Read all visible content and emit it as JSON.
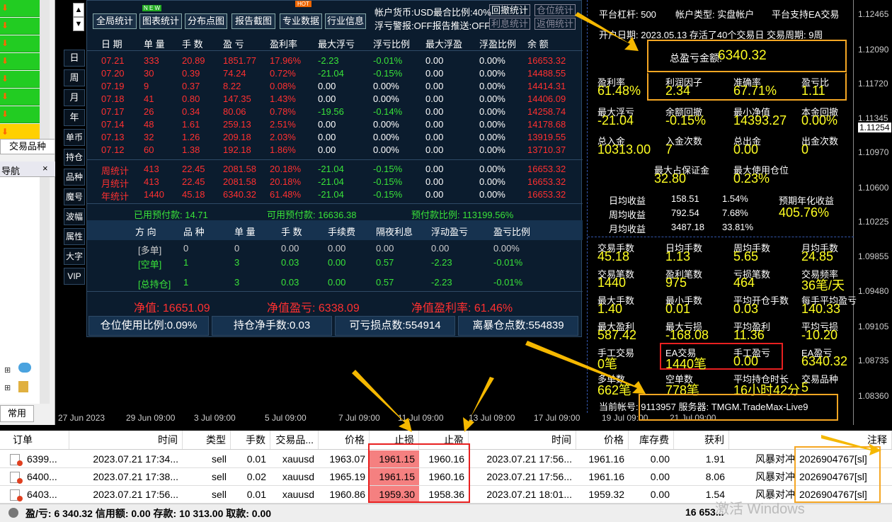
{
  "left": {
    "tab1": "交易品种",
    "nav": "导航",
    "close": "×",
    "common": "常用"
  },
  "topbuttons": [
    "全局统计",
    "图表统计",
    "分布点图",
    "报告截图",
    "专业数据",
    "行业信息"
  ],
  "badges": {
    "new": "N E W",
    "hot": "HOT"
  },
  "account_line1": "帐户货币:USD最合比例:40%",
  "account_line2": "浮亏警报:OFF报告推送:OFF",
  "actbtns": [
    "回撤统计",
    "仓位统计",
    "利息统计",
    "返佣统计"
  ],
  "side_tabs": [
    "日",
    "周",
    "月",
    "年",
    "单币",
    "持仓",
    "品种",
    "魔号",
    "波幅",
    "属性",
    "大字",
    "VIP"
  ],
  "headers": [
    "日 期",
    "单 量",
    "手 数",
    "盈 亏",
    "盈利率",
    "最大浮亏",
    "浮亏比例",
    "最大浮盈",
    "浮盈比例",
    "余 额"
  ],
  "rows": [
    [
      "07.21",
      "333",
      "20.89",
      "1851.77",
      "17.96%",
      "-2.23",
      "-0.01%",
      "0.00",
      "0.00%",
      "16653.32"
    ],
    [
      "07.20",
      "30",
      "0.39",
      "74.24",
      "0.72%",
      "-21.04",
      "-0.15%",
      "0.00",
      "0.00%",
      "14488.55"
    ],
    [
      "07.19",
      "9",
      "0.37",
      "8.22",
      "0.08%",
      "0.00",
      "0.00%",
      "0.00",
      "0.00%",
      "14414.31"
    ],
    [
      "07.18",
      "41",
      "0.80",
      "147.35",
      "1.43%",
      "0.00",
      "0.00%",
      "0.00",
      "0.00%",
      "14406.09"
    ],
    [
      "07.17",
      "26",
      "0.34",
      "80.06",
      "0.78%",
      "-19.56",
      "-0.14%",
      "0.00",
      "0.00%",
      "14258.74"
    ],
    [
      "07.14",
      "48",
      "1.61",
      "259.13",
      "2.51%",
      "0.00",
      "0.00%",
      "0.00",
      "0.00%",
      "14178.68"
    ],
    [
      "07.13",
      "32",
      "1.26",
      "209.18",
      "2.03%",
      "0.00",
      "0.00%",
      "0.00",
      "0.00%",
      "13919.55"
    ],
    [
      "07.12",
      "60",
      "1.38",
      "192.18",
      "1.86%",
      "0.00",
      "0.00%",
      "0.00",
      "0.00%",
      "13710.37"
    ]
  ],
  "sumrows": [
    [
      "周统计",
      "413",
      "22.45",
      "2081.58",
      "20.18%",
      "-21.04",
      "-0.15%",
      "0.00",
      "0.00%",
      "16653.32"
    ],
    [
      "月统计",
      "413",
      "22.45",
      "2081.58",
      "20.18%",
      "-21.04",
      "-0.15%",
      "0.00",
      "0.00%",
      "16653.32"
    ],
    [
      "年统计",
      "1440",
      "45.18",
      "6340.32",
      "61.48%",
      "-21.04",
      "-0.15%",
      "0.00",
      "0.00%",
      "16653.32"
    ]
  ],
  "margin": {
    "used": "已用预付款: 14.71",
    "avail": "可用预付款: 16636.38",
    "ratio": "预付款比例: 113199.56%"
  },
  "pos_headers": [
    "方 向",
    "品 种",
    "单 量",
    "手 数",
    "手续费",
    "隔夜利息",
    "浮动盈亏",
    "盈亏比例"
  ],
  "pos_rows": [
    [
      "[多单]",
      "0",
      "0",
      "0.00",
      "0.00",
      "0.00",
      "0.00",
      "0.00%"
    ],
    [
      "[空单]",
      "1",
      "3",
      "0.03",
      "0.00",
      "0.57",
      "-2.23",
      "-0.01%"
    ],
    [
      "[总持仓]",
      "1",
      "3",
      "0.03",
      "0.00",
      "0.57",
      "-2.23",
      "-0.01%"
    ]
  ],
  "netline": {
    "equity": "净值: 16651.09",
    "profit": "净值盈亏: 6338.09",
    "rate": "净值盈利率: 61.46%"
  },
  "bottombar": [
    "仓位使用比例:0.09%",
    "持仓净手数:0.03",
    "可亏损点数:554914",
    "离暴仓点数:554839"
  ],
  "right": {
    "lev": "平台杠杆: 500",
    "acctype": "帐户类型: 实盘帐户",
    "ea": "平台支持EA交易",
    "open": "开户日期: 2023.05.13 存活了40个交易日 交易周期: 9周",
    "total_label": "总盈亏金额:",
    "total": "6340.32",
    "g1": [
      [
        "盈利率",
        "61.48%"
      ],
      [
        "利润因子",
        "2.34"
      ],
      [
        "准确率",
        "67.71%"
      ],
      [
        "盈亏比",
        "1.11"
      ]
    ],
    "g2": [
      [
        "最大浮亏",
        "-21.04"
      ],
      [
        "余额回撤",
        "-0.15%"
      ],
      [
        "最小净值",
        "14393.27"
      ],
      [
        "本金回撤",
        "0.00%"
      ]
    ],
    "g3": [
      [
        "总入金",
        "10313.00"
      ],
      [
        "入金次数",
        "7"
      ],
      [
        "总出金",
        "0.00"
      ],
      [
        "出金次数",
        "0"
      ]
    ],
    "g4": [
      [
        "最大占保证金",
        "32.80"
      ],
      [
        "最大使用仓位",
        "0.23%"
      ]
    ],
    "daily": [
      [
        "日均收益",
        "158.51",
        "1.54%"
      ],
      [
        "周均收益",
        "792.54",
        "7.68%"
      ],
      [
        "月均收益",
        "3487.18",
        "33.81%"
      ]
    ],
    "annual_label": "预期年化收益",
    "annual": "405.76%",
    "g5": [
      [
        "交易手数",
        "45.18"
      ],
      [
        "日均手数",
        "1.13"
      ],
      [
        "周均手数",
        "5.65"
      ],
      [
        "月均手数",
        "24.85"
      ]
    ],
    "g6": [
      [
        "交易笔数",
        "1440"
      ],
      [
        "盈利笔数",
        "975"
      ],
      [
        "亏损笔数",
        "464"
      ],
      [
        "交易频率",
        "36笔/天"
      ]
    ],
    "g7": [
      [
        "最大手数",
        "1.40"
      ],
      [
        "最小手数",
        "0.01"
      ],
      [
        "平均开仓手数",
        "0.03"
      ],
      [
        "每手平均盈亏",
        "140.33"
      ]
    ],
    "g8": [
      [
        "最大盈利",
        "587.42"
      ],
      [
        "最大亏损",
        "-168.08"
      ],
      [
        "平均盈利",
        "11.36"
      ],
      [
        "平均亏损",
        "-10.20"
      ]
    ],
    "g9": [
      [
        "手工交易",
        "0笔"
      ],
      [
        "EA交易",
        "1440笔"
      ],
      [
        "手工盈亏",
        "0.00"
      ],
      [
        "EA盈亏",
        "6340.32"
      ]
    ],
    "g10": [
      [
        "多单数",
        "662笔"
      ],
      [
        "空单数",
        "778笔"
      ],
      [
        "平均持仓时长",
        "16小时42分"
      ],
      [
        "交易品种",
        "5"
      ]
    ],
    "acct": "当前帐号: 9113957 服务器: TMGM.TradeMax-Live9"
  },
  "yaxis": [
    "1.12465",
    "1.12090",
    "1.11720",
    "1.11345",
    "1.11254",
    "1.10970",
    "1.10600",
    "1.10225",
    "1.09855",
    "1.09480",
    "1.09105",
    "1.08735",
    "1.08360"
  ],
  "xaxis": [
    "27 Jun 2023",
    "29 Jun 09:00",
    "3 Jul 09:00",
    "5 Jul 09:00",
    "7 Jul 09:00",
    "11 Jul 09:00",
    "13 Jul 09:00",
    "17 Jul 09:00",
    "19 Jul 09:00",
    "21 Jul 09:00"
  ],
  "table": {
    "headers": [
      "订单",
      "时间",
      "类型",
      "手数",
      "交易品...",
      "价格",
      "止损",
      "止盈",
      "时间",
      "价格",
      "库存费",
      "获利",
      "注释"
    ],
    "rows": [
      [
        "6399...",
        "2023.07.21 17:34...",
        "sell",
        "0.01",
        "xauusd",
        "1963.07",
        "1961.15",
        "1960.16",
        "2023.07.21 17:56...",
        "1961.16",
        "0.00",
        "1.91",
        "风暴对冲",
        "2026904767[sl]"
      ],
      [
        "6400...",
        "2023.07.21 17:38...",
        "sell",
        "0.02",
        "xauusd",
        "1965.19",
        "1961.15",
        "1960.16",
        "2023.07.21 17:56...",
        "1961.16",
        "0.00",
        "8.06",
        "风暴对冲",
        "2026904767[sl]"
      ],
      [
        "6403...",
        "2023.07.21 17:56...",
        "sell",
        "0.01",
        "xauusd",
        "1960.86",
        "1959.30",
        "1958.36",
        "2023.07.21 18:01...",
        "1959.32",
        "0.00",
        "1.54",
        "风暴对冲",
        "2026904767[sl]"
      ]
    ],
    "footer": "盈/亏: 6 340.32  信用额: 0.00  存款: 10 313.00  取款: 0.00",
    "footer_right": "16 653...",
    "watermark": "激活 Windows"
  },
  "colors": {
    "accent": "#f5a623",
    "red": "#ff3030",
    "green": "#39e339",
    "yellow": "#ffff22"
  }
}
